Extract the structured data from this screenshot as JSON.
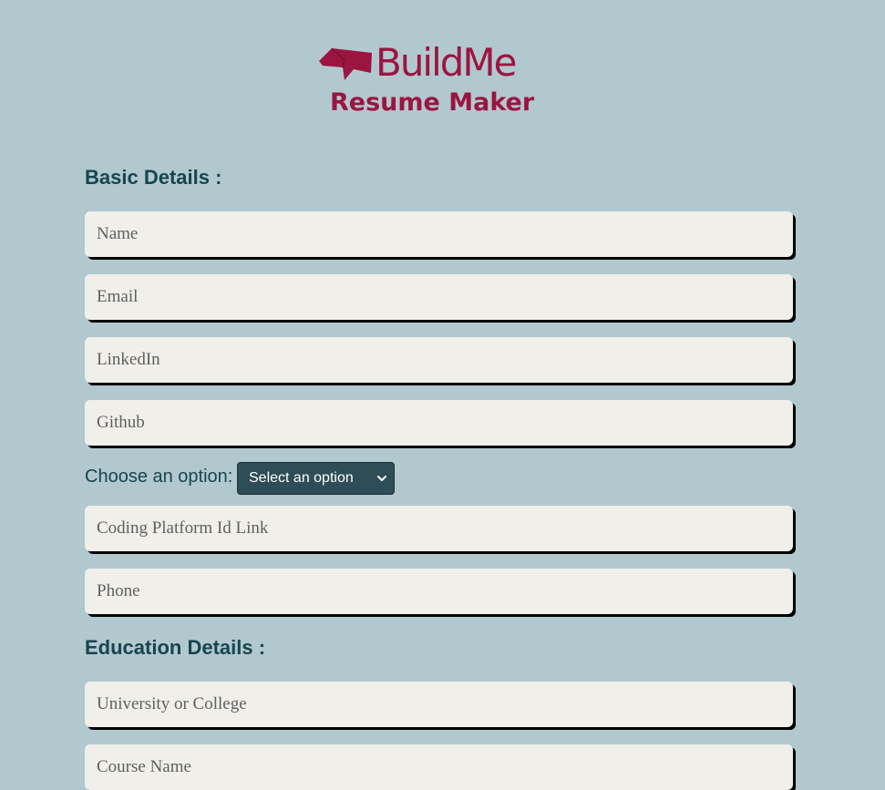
{
  "header": {
    "brand": "BuildMe",
    "subtitle": "Resume Maker"
  },
  "basic_details": {
    "heading": "Basic Details :",
    "name_placeholder": "Name",
    "email_placeholder": "Email",
    "linkedin_placeholder": "LinkedIn",
    "github_placeholder": "Github",
    "choose_label": "Choose an option:",
    "select_value": "Select an option",
    "coding_placeholder": "Coding Platform Id Link",
    "phone_placeholder": "Phone"
  },
  "education_details": {
    "heading": "Education Details :",
    "university_placeholder": "University or College",
    "course_placeholder": "Course Name"
  },
  "colors": {
    "background": "#b2c8cf",
    "brand": "#9b1540",
    "heading": "#17454f",
    "field_bg": "#f0efe9",
    "select_bg": "#2e4d56"
  },
  "icons": {
    "logo": "buildme-logo-icon",
    "select_arrow": "chevron-down-icon"
  }
}
